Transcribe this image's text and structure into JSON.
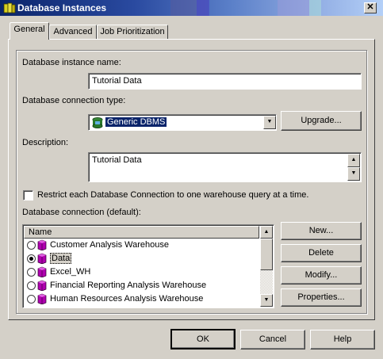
{
  "window": {
    "title": "Database Instances",
    "close_glyph": "✕"
  },
  "tabs": [
    {
      "label": "General",
      "active": true
    },
    {
      "label": "Advanced",
      "active": false
    },
    {
      "label": "Job Prioritization",
      "active": false
    }
  ],
  "general": {
    "instance_name_label": "Database instance name:",
    "instance_name_value": "Tutorial Data",
    "connection_type_label": "Database connection type:",
    "connection_type_value": "Generic DBMS",
    "upgrade_label": "Upgrade...",
    "description_label": "Description:",
    "description_value": "Tutorial Data",
    "restrict_label": "Restrict each Database Connection to one warehouse query at a time.",
    "restrict_checked": false,
    "connection_list_label": "Database connection (default):",
    "list_header": "Name",
    "connections": [
      {
        "name": "Customer Analysis Warehouse",
        "selected": false
      },
      {
        "name": "Data",
        "selected": true
      },
      {
        "name": "Excel_WH",
        "selected": false
      },
      {
        "name": "Financial Reporting Analysis Warehouse",
        "selected": false
      },
      {
        "name": "Human Resources Analysis Warehouse",
        "selected": false
      }
    ],
    "buttons": {
      "new": "New...",
      "delete": "Delete",
      "modify": "Modify...",
      "properties": "Properties..."
    }
  },
  "footer": {
    "ok": "OK",
    "cancel": "Cancel",
    "help": "Help"
  },
  "icons": {
    "title": "database-instances-icon",
    "connection": "database-cube-icon"
  },
  "colors": {
    "title_start": "#0a246a",
    "title_end": "#b4d0f8",
    "selection": "#0a246a",
    "cube": "#b000b0"
  }
}
